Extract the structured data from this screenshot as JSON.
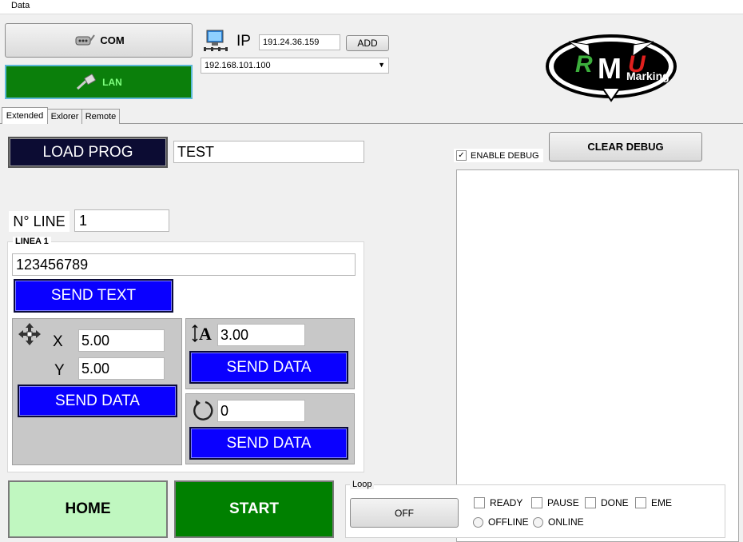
{
  "menu": {
    "data_label": "Data"
  },
  "connection": {
    "com_label": "COM",
    "lan_label": "LAN",
    "ip_label": "IP",
    "ip_value": "191.24.36.159",
    "add_label": "ADD",
    "ip_selected": "192.168.101.100"
  },
  "logo": {
    "text": "Marking",
    "brand_letters": "RMU"
  },
  "tabs": [
    {
      "label": "Extended"
    },
    {
      "label": "Exlorer"
    },
    {
      "label": "Remote"
    }
  ],
  "program": {
    "load_label": "LOAD PROG",
    "name_value": "TEST"
  },
  "line": {
    "label": "N° LINE",
    "value": "1"
  },
  "linea": {
    "group_label": "LINEA 1",
    "text_value": "123456789",
    "send_text_label": "SEND TEXT"
  },
  "position": {
    "x_label": "X",
    "x_value": "5.00",
    "y_label": "Y",
    "y_value": "5.00",
    "send_label": "SEND DATA"
  },
  "height": {
    "value": "3.00",
    "send_label": "SEND DATA"
  },
  "rotation": {
    "value": "0",
    "send_label": "SEND DATA"
  },
  "debug": {
    "enable_label": "ENABLE DEBUG",
    "enabled": true,
    "clear_label": "CLEAR DEBUG"
  },
  "bottom": {
    "home_label": "HOME",
    "start_label": "START"
  },
  "loop": {
    "group_label": "Loop",
    "off_label": "OFF"
  },
  "status": {
    "ready": "READY",
    "pause": "PAUSE",
    "done": "DONE",
    "eme": "EME",
    "offline": "OFFLINE",
    "online": "ONLINE"
  },
  "colors": {
    "blue_button": "#0a00ff",
    "start_green": "#008000",
    "home_green": "#c0f7c0",
    "lan_green": "#0b7f0b",
    "load_navy": "#0c0c33"
  }
}
